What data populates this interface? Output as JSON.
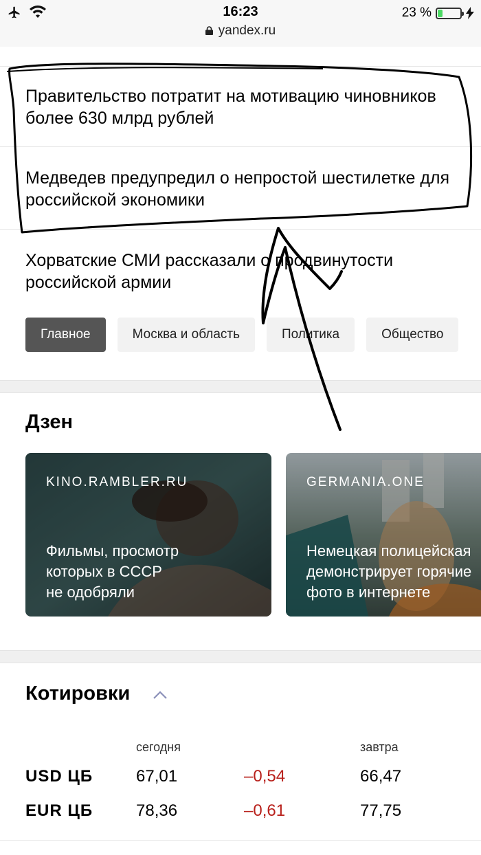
{
  "status_bar": {
    "time": "16:23",
    "url": "yandex.ru",
    "battery_text": "23 %",
    "battery_level": 0.23,
    "icons": [
      "airplane-icon",
      "wifi-icon",
      "lock-icon",
      "charging-icon"
    ]
  },
  "news": {
    "items": [
      "Правительство потратит на мотивацию чиновников более 630 млрд рублей",
      "Медведев предупредил о непростой шестилетке для российской экономики",
      "Хорватские СМИ рассказали о продвинутости российской армии"
    ],
    "tabs": [
      {
        "label": "Главное",
        "active": true
      },
      {
        "label": "Москва и область",
        "active": false
      },
      {
        "label": "Политика",
        "active": false
      },
      {
        "label": "Общество",
        "active": false
      }
    ]
  },
  "dzen": {
    "title": "Дзен",
    "cards": [
      {
        "source": "KINO.RAMBLER.RU",
        "title_lines": [
          "Фильмы, просмотр",
          "которых в СССР",
          "не одобряли"
        ]
      },
      {
        "source": "GERMANIA.ONE",
        "title_lines": [
          "Немецкая полицейская",
          "демонстрирует горячие",
          "фото в интернете"
        ]
      }
    ]
  },
  "quotes": {
    "title": "Котировки",
    "col_today": "сегодня",
    "col_tomorrow": "завтра",
    "rows": [
      {
        "name": "USD ЦБ",
        "today": "67,01",
        "delta": "–0,54",
        "tomorrow": "66,47"
      },
      {
        "name": "EUR ЦБ",
        "today": "78,36",
        "delta": "–0,61",
        "tomorrow": "77,75"
      }
    ]
  },
  "colors": {
    "negative": "#b8201b",
    "active_tab": "#555555",
    "tab_bg": "#f2f2f2"
  }
}
